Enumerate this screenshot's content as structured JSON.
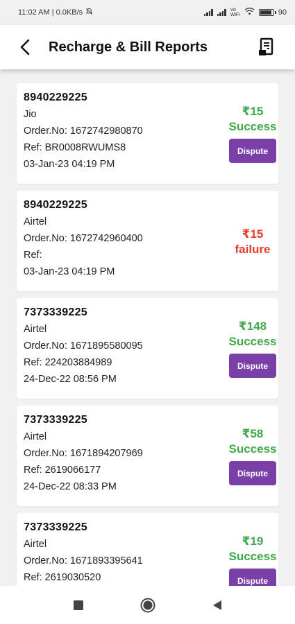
{
  "status_bar": {
    "time_network": "11:02 AM | 0.0KB/s",
    "silent_icon": "bell-off-icon",
    "volte_label": "Vo",
    "wifi_label": "WiFi",
    "battery": "90"
  },
  "header": {
    "title": "Recharge & Bill Reports",
    "back_icon": "back-arrow-icon",
    "report_icon": "receipt-icon"
  },
  "colors": {
    "success": "#3fa94a",
    "failure": "#e53b2c",
    "dispute_button": "#7b3fa8"
  },
  "transactions": [
    {
      "number": "8940229225",
      "operator": "Jio",
      "order": "Order.No: 1672742980870",
      "ref": "Ref: BR0008RWUMS8",
      "date": "03-Jan-23 04:19 PM",
      "amount": "₹15",
      "status": "Success",
      "dispute_label": "Dispute"
    },
    {
      "number": "8940229225",
      "operator": "Airtel",
      "order": "Order.No: 1672742960400",
      "ref": "Ref:",
      "date": "03-Jan-23 04:19 PM",
      "amount": "₹15",
      "status": "failure"
    },
    {
      "number": "7373339225",
      "operator": "Airtel",
      "order": "Order.No: 1671895580095",
      "ref": "Ref: 224203884989",
      "date": "24-Dec-22 08:56 PM",
      "amount": "₹148",
      "status": "Success",
      "dispute_label": "Dispute"
    },
    {
      "number": "7373339225",
      "operator": "Airtel",
      "order": "Order.No: 1671894207969",
      "ref": "Ref: 2619066177",
      "date": "24-Dec-22 08:33 PM",
      "amount": "₹58",
      "status": "Success",
      "dispute_label": "Dispute"
    },
    {
      "number": "7373339225",
      "operator": "Airtel",
      "order": "Order.No: 1671893395641",
      "ref": "Ref: 2619030520",
      "date": "",
      "amount": "₹19",
      "status": "Success",
      "dispute_label": "Dispute"
    }
  ],
  "nav": {
    "recents_icon": "square-icon",
    "home_icon": "circle-icon",
    "back_icon": "triangle-back-icon"
  }
}
